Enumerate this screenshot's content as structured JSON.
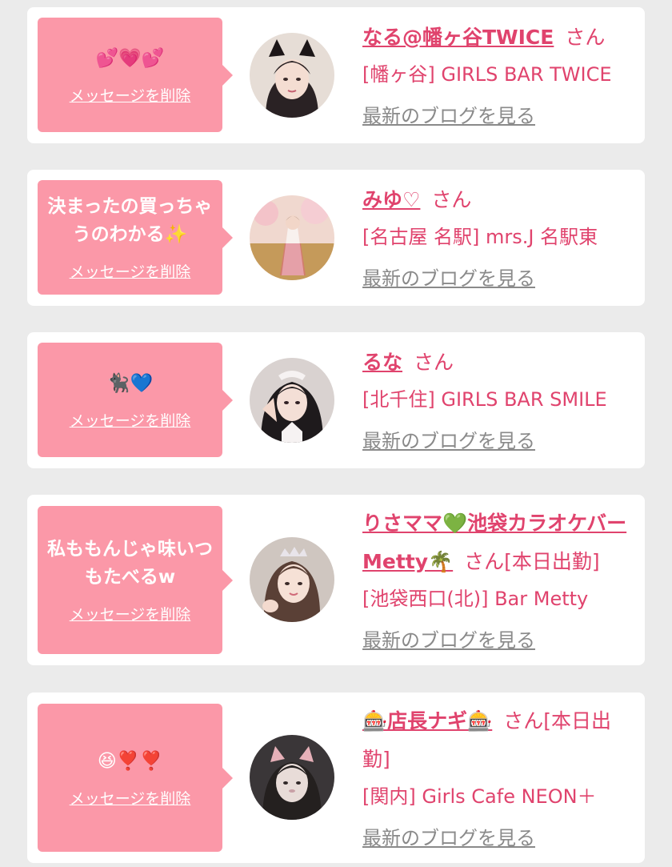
{
  "colors": {
    "accent": "#e0436d",
    "bubble": "#fb98a8",
    "page_bg": "#ebebeb",
    "link_gray": "#8a8a8a"
  },
  "items": [
    {
      "message": "💕💗💕",
      "delete_label": "メッセージを削除",
      "name": "なる@幡ヶ谷TWICE",
      "honorific": "さん",
      "shop": "[幡ヶ谷] GIRLS BAR TWICE",
      "blog_label": "最新のブログを見る"
    },
    {
      "message": "決まったの買っちゃうのわかる✨",
      "delete_label": "メッセージを削除",
      "name": "みゆ♡",
      "honorific": "さん",
      "shop": "[名古屋 名駅] mrs.J 名駅東",
      "blog_label": "最新のブログを見る"
    },
    {
      "message": "🐈‍⬛💙",
      "delete_label": "メッセージを削除",
      "name": "るな",
      "honorific": "さん",
      "shop": "[北千住] GIRLS BAR SMILE",
      "blog_label": "最新のブログを見る"
    },
    {
      "message": "私ももんじゃ味いつもたべるw",
      "delete_label": "メッセージを削除",
      "name": "りさママ💚池袋カラオケバーMetty🌴",
      "honorific": "さん[本日出勤]",
      "shop": "[池袋西口(北)] Bar Metty",
      "blog_label": "最新のブログを見る"
    },
    {
      "message": "😆❣️❣️",
      "delete_label": "メッセージを削除",
      "name": "🎰店長ナギ🎰",
      "honorific": "さん[本日出勤]",
      "shop": "[関内] Girls Cafe NEON＋",
      "blog_label": "最新のブログを見る"
    }
  ]
}
